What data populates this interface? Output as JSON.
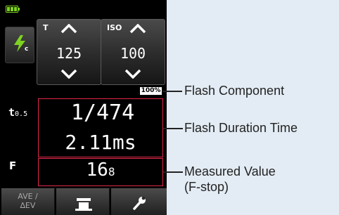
{
  "screen": {
    "battery_level": 1.0,
    "mode_sub": "c",
    "shutter": {
      "label": "T",
      "value": "125"
    },
    "iso": {
      "label": "ISO",
      "value": "100"
    },
    "flash_percent": "100%",
    "duration_label": "t",
    "duration_sub": "0.5",
    "duration_fraction": "1/474",
    "duration_ms": "2.11ms",
    "f_label": "F",
    "f_value_main": "16",
    "f_value_tenth": "8",
    "bottom": {
      "ave_label": "AVE /\n∆EV"
    }
  },
  "callouts": {
    "flash_component": "Flash Component",
    "flash_duration_time": "Flash Duration Time",
    "measured_value": "Measured Value\n(F-stop)"
  },
  "colors": {
    "highlight_red": "#e0284a",
    "battery_green": "#7ed321",
    "background": "#e3ecf4"
  },
  "icons": {
    "mode": "flash-cordless-icon",
    "up": "chevron-up-icon",
    "down": "chevron-down-icon",
    "meter": "meter-icon",
    "settings": "wrench-icon"
  }
}
